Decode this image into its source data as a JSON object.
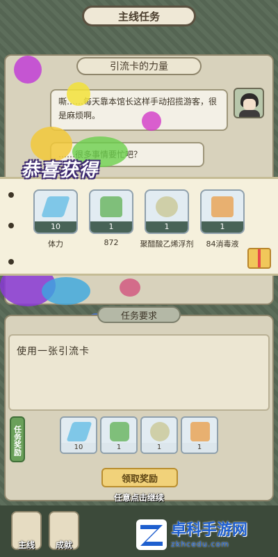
{
  "header": {
    "title": "主线任务"
  },
  "dialogue": {
    "title": "引流卡的力量",
    "bubble_1": "嘶……每天靠本馆长这样手动招揽游客，很是麻烦啊。",
    "bubble_2": "……很多事情要忙吧？"
  },
  "reward_popup": {
    "heading": "恭喜获得",
    "items": [
      {
        "name": "体力",
        "count": "10",
        "icon": "stamina-crystal-icon",
        "color": "#7fc7e8"
      },
      {
        "name": "872",
        "count": "1",
        "icon": "cleaner-bottle-icon",
        "color": "#7fbf7a"
      },
      {
        "name": "聚醋酸乙烯浮剂",
        "count": "1",
        "icon": "chemical-can-icon",
        "color": "#cfcfa8"
      },
      {
        "name": "84消毒液",
        "count": "1",
        "icon": "disinfectant-bottle-icon",
        "color": "#e8b070"
      }
    ]
  },
  "task": {
    "title": "任务要求",
    "description": "使用一张引流卡",
    "reward_label": "任务奖励",
    "rewards": [
      {
        "count": "10",
        "icon": "stamina-crystal-icon",
        "color": "#7fc7e8"
      },
      {
        "count": "1",
        "icon": "cleaner-bottle-icon",
        "color": "#7fbf7a"
      },
      {
        "count": "1",
        "icon": "chemical-can-icon",
        "color": "#cfcfa8"
      },
      {
        "count": "1",
        "icon": "disinfectant-bottle-icon",
        "color": "#e8b070"
      }
    ],
    "claim_button": "领取奖励",
    "continue_hint": "任意点击继续"
  },
  "bottom_nav": {
    "main_line": "主线",
    "achievement": "成就"
  },
  "watermark": {
    "main": "卓科手游网",
    "sub": "zkhcedu.com"
  }
}
